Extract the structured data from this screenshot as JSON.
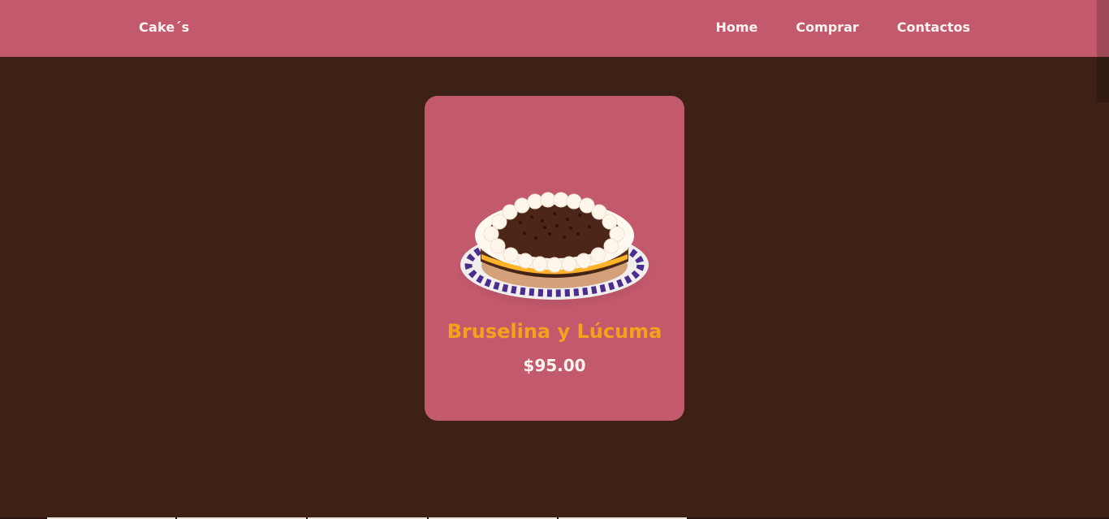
{
  "header": {
    "brand": "Cake´s",
    "nav": [
      {
        "label": "Home"
      },
      {
        "label": "Comprar"
      },
      {
        "label": "Contactos"
      }
    ]
  },
  "product": {
    "name": "Bruselina y Lúcuma",
    "price": "$95.00",
    "image": "cake-photo"
  },
  "colors": {
    "header_bg": "#c2596c",
    "page_bg": "#3d2114",
    "card_bg": "#c2596c",
    "title": "#f4a11d",
    "text": "#fff3ef"
  }
}
